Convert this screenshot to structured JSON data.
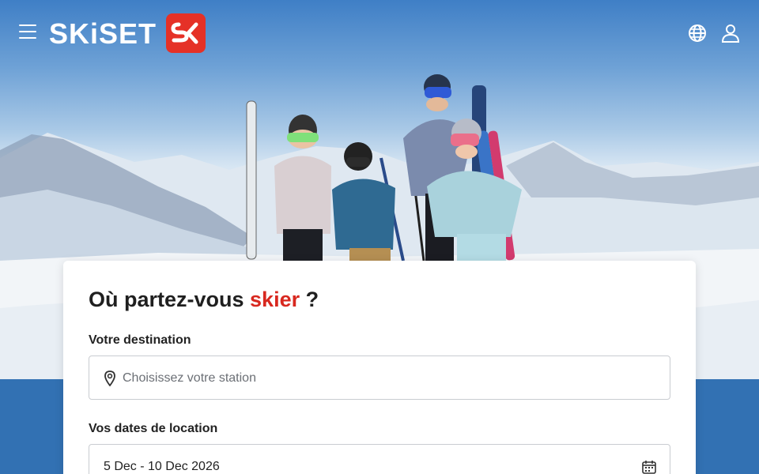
{
  "header": {
    "logo_text": "SKiSET",
    "icons": {
      "menu": "hamburger-icon",
      "language": "globe-icon",
      "account": "user-icon"
    }
  },
  "search": {
    "title_part1": "Où partez-vous ",
    "title_accent": "skier",
    "title_part2": " ?",
    "destination_label": "Votre destination",
    "destination_placeholder": "Choisissez votre station",
    "dates_label": "Vos dates de location",
    "dates_value": "5 Dec - 10 Dec 2026"
  },
  "colors": {
    "brand_red": "#e53127",
    "accent_text": "#d8281f",
    "sky_blue": "#3271b3"
  }
}
